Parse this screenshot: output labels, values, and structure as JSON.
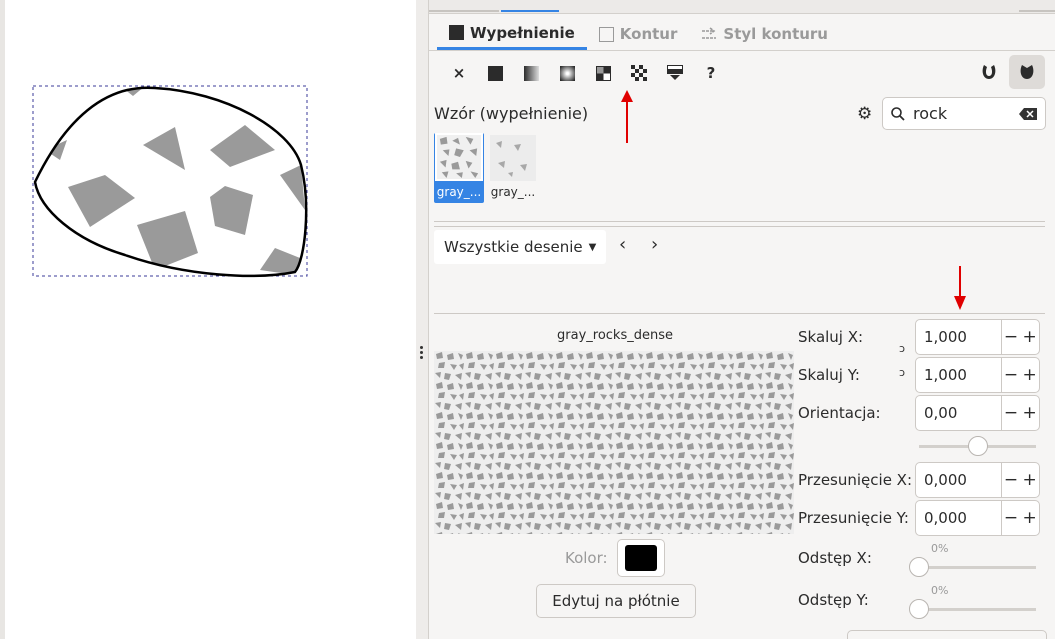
{
  "tabs": [
    {
      "label": "Wypełnienie",
      "active": true
    },
    {
      "label": "Kontur",
      "active": false
    },
    {
      "label": "Styl konturu",
      "active": false
    }
  ],
  "fill_modes": [
    {
      "name": "no-paint",
      "glyph": "×"
    },
    {
      "name": "flat-color",
      "glyph": ""
    },
    {
      "name": "linear-gradient",
      "glyph": ""
    },
    {
      "name": "radial-gradient",
      "glyph": ""
    },
    {
      "name": "mesh-gradient",
      "glyph": ""
    },
    {
      "name": "pattern",
      "glyph": ""
    },
    {
      "name": "swatch",
      "glyph": ""
    },
    {
      "name": "unset",
      "glyph": "?"
    }
  ],
  "pattern_section": {
    "label": "Wzór (wypełnienie)",
    "search_value": "rock",
    "thumbs": [
      {
        "label": "gray_...",
        "selected": true
      },
      {
        "label": "gray_...",
        "selected": false
      }
    ],
    "collection": "Wszystkie desenie",
    "pattern_name": "gray_rocks_dense",
    "color_label": "Kolor:",
    "color": "#000000",
    "edit_button": "Edytuj na płótnie"
  },
  "properties": {
    "scale_x": {
      "label": "Skaluj X:",
      "value": "1,000"
    },
    "scale_y": {
      "label": "Skaluj Y:",
      "value": "1,000"
    },
    "orientation": {
      "label": "Orientacja:",
      "value": "0,00",
      "slider": 0.5
    },
    "offset_x": {
      "label": "Przesunięcie X:",
      "value": "0,000"
    },
    "offset_y": {
      "label": "Przesunięcie Y:",
      "value": "0,000"
    },
    "gap_x": {
      "label": "Odstęp X:",
      "value": "0%",
      "slider": 0
    },
    "gap_y": {
      "label": "Odstęp Y:",
      "value": "0%",
      "slider": 0
    }
  },
  "spin_buttons": {
    "minus": "−",
    "plus": "+"
  },
  "colors": {
    "accent": "#3584e4",
    "annotation_arrow": "#e00000",
    "rock": "#9a9a9a"
  }
}
